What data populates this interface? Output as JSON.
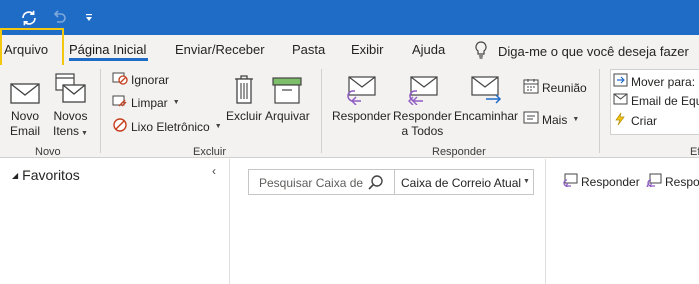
{
  "tabs": {
    "file": "Arquivo",
    "home": "Página Inicial",
    "send_receive": "Enviar/Receber",
    "folder": "Pasta",
    "view": "Exibir",
    "help": "Ajuda"
  },
  "tell_me": "Diga-me o que você deseja fazer",
  "ribbon": {
    "new_group": {
      "label": "Novo",
      "new_email_line1": "Novo",
      "new_email_line2": "Email",
      "new_items_line1": "Novos",
      "new_items_line2": "Itens"
    },
    "delete_group": {
      "label": "Excluir",
      "ignore": "Ignorar",
      "clean": "Limpar",
      "junk": "Lixo Eletrônico",
      "delete": "Excluir",
      "archive": "Arquivar"
    },
    "respond_group": {
      "label": "Responder",
      "reply": "Responder",
      "reply_all_line1": "Responder",
      "reply_all_line2": "a Todos",
      "forward": "Encaminhar",
      "meeting": "Reunião",
      "more": "Mais"
    },
    "quick_steps": {
      "move_to": "Mover para:",
      "email_team": "Email de Equ",
      "create": "Criar",
      "label_partial": "Ef"
    }
  },
  "navigation": {
    "favorites": "Favoritos",
    "collapse_glyph": "‹"
  },
  "search": {
    "placeholder": "Pesquisar Caixa de Correio Atual",
    "scope": "Caixa de Correio Atual"
  },
  "reading_pane": {
    "reply": "Responder",
    "reply_all_partial": "Respon"
  },
  "colors": {
    "titlebar": "#1f6cc7",
    "ribbon_bg": "#f3f2f1",
    "highlight": "#f2c811",
    "accent": "#1f6cc7"
  }
}
